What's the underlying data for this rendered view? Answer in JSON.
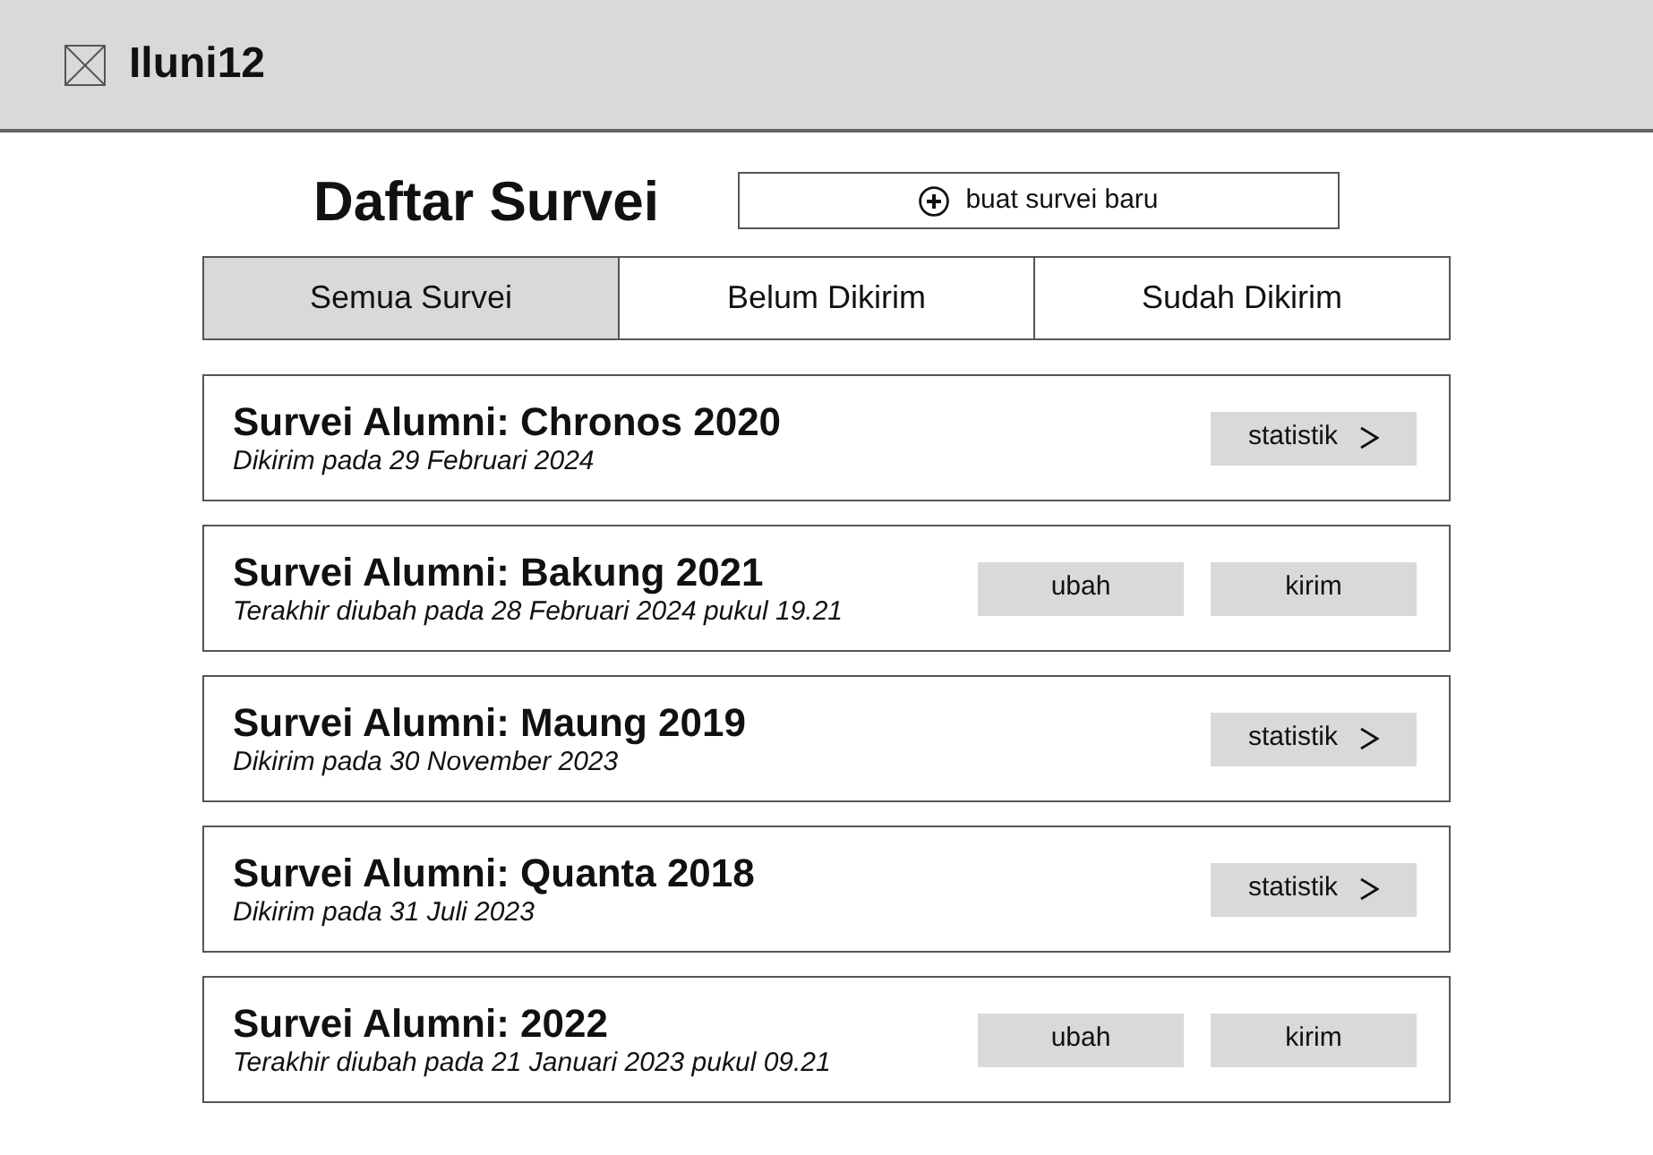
{
  "app": {
    "name": "Iluni12"
  },
  "page": {
    "title": "Daftar Survei",
    "new_button": "buat survei baru"
  },
  "tabs": [
    {
      "label": "Semua Survei",
      "selected": true
    },
    {
      "label": "Belum Dikirim",
      "selected": false
    },
    {
      "label": "Sudah Dikirim",
      "selected": false
    }
  ],
  "surveys": [
    {
      "title": "Survei Alumni: Chronos 2020",
      "subtitle": "Dikirim pada 29 Februari 2024",
      "actions": [
        {
          "kind": "stats",
          "label": "statistik"
        }
      ]
    },
    {
      "title": "Survei Alumni: Bakung 2021",
      "subtitle": "Terakhir diubah pada 28 Februari 2024 pukul 19.21",
      "actions": [
        {
          "kind": "edit",
          "label": "ubah"
        },
        {
          "kind": "send",
          "label": "kirim"
        }
      ]
    },
    {
      "title": "Survei Alumni: Maung 2019",
      "subtitle": "Dikirim pada 30 November 2023",
      "actions": [
        {
          "kind": "stats",
          "label": "statistik"
        }
      ]
    },
    {
      "title": "Survei Alumni: Quanta 2018",
      "subtitle": "Dikirim pada 31 Juli 2023",
      "actions": [
        {
          "kind": "stats",
          "label": "statistik"
        }
      ]
    },
    {
      "title": "Survei Alumni: 2022",
      "subtitle": "Terakhir diubah pada 21 Januari 2023 pukul 09.21",
      "actions": [
        {
          "kind": "edit",
          "label": "ubah"
        },
        {
          "kind": "send",
          "label": "kirim"
        }
      ]
    }
  ]
}
